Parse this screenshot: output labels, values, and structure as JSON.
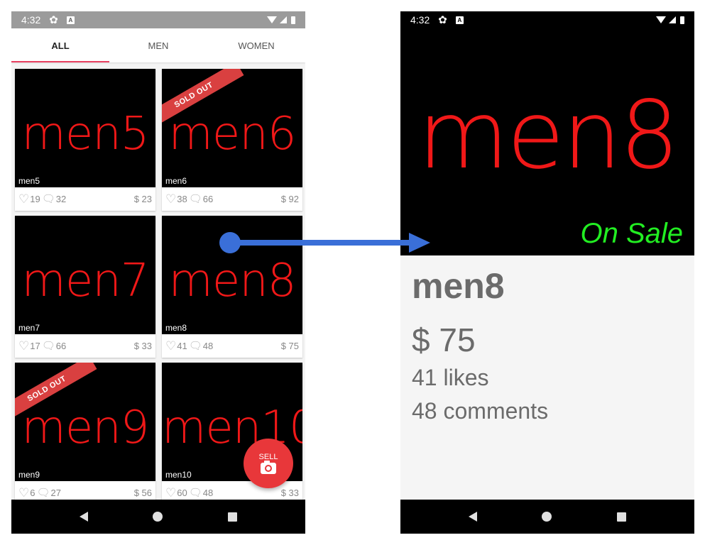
{
  "colors": {
    "accent": "#e84060",
    "item_text": "#f01818",
    "sold_out_ribbon": "#d94040",
    "on_sale": "#22ee22",
    "fab": "#e8373a",
    "arrow": "#3a6fd8"
  },
  "left_screen": {
    "status": {
      "time": "4:32",
      "icons": [
        "gear-icon",
        "a-badge-icon",
        "wifi-icon",
        "signal-icon",
        "battery-icon"
      ]
    },
    "tabs": [
      {
        "label": "ALL",
        "active": true
      },
      {
        "label": "MEN",
        "active": false
      },
      {
        "label": "WOMEN",
        "active": false
      }
    ],
    "cards": [
      {
        "big_text": "men5",
        "name": "men5",
        "likes": "19",
        "comments": "32",
        "price": "$ 23",
        "sold_out": false
      },
      {
        "big_text": "men6",
        "name": "men6",
        "likes": "38",
        "comments": "66",
        "price": "$ 92",
        "sold_out": true
      },
      {
        "big_text": "men7",
        "name": "men7",
        "likes": "17",
        "comments": "66",
        "price": "$ 33",
        "sold_out": false
      },
      {
        "big_text": "men8",
        "name": "men8",
        "likes": "41",
        "comments": "48",
        "price": "$ 75",
        "sold_out": false
      },
      {
        "big_text": "men9",
        "name": "men9",
        "likes": "6",
        "comments": "27",
        "price": "$ 56",
        "sold_out": true
      },
      {
        "big_text": "men10",
        "name": "men10",
        "likes": "60",
        "comments": "48",
        "price": "$ 33",
        "sold_out": false
      }
    ],
    "sold_out_label": "SOLD OUT",
    "fab": {
      "label": "SELL",
      "icon": "camera-icon"
    }
  },
  "right_screen": {
    "status": {
      "time": "4:32"
    },
    "image_text": "men8",
    "on_sale": "On Sale",
    "name": "men8",
    "price": "$ 75",
    "likes": "41 likes",
    "comments": "48 comments"
  }
}
